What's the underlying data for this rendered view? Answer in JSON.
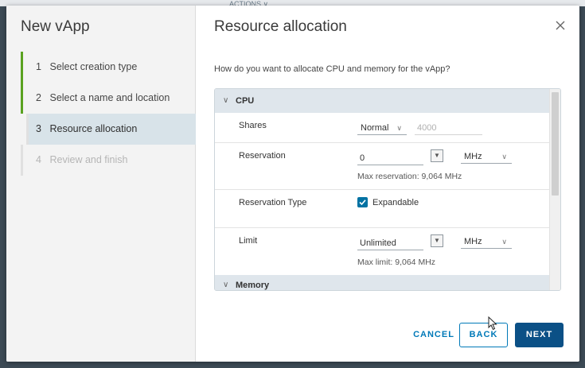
{
  "backdrop": {
    "fragment": "ACTIONS ∨"
  },
  "wizard": {
    "title": "New vApp",
    "steps": [
      {
        "num": "1",
        "label": "Select creation type",
        "state": "done"
      },
      {
        "num": "2",
        "label": "Select a name and location",
        "state": "done"
      },
      {
        "num": "3",
        "label": "Resource allocation",
        "state": "active"
      },
      {
        "num": "4",
        "label": "Review and finish",
        "state": "disabled"
      }
    ]
  },
  "page": {
    "title": "Resource allocation",
    "question": "How do you want to allocate CPU and memory for the vApp?"
  },
  "cpu": {
    "section_label": "CPU",
    "shares": {
      "label": "Shares",
      "level": "Normal",
      "value": "4000"
    },
    "reservation": {
      "label": "Reservation",
      "value": "0",
      "unit": "MHz",
      "hint": "Max reservation: 9,064 MHz"
    },
    "reservation_type": {
      "label": "Reservation Type",
      "checkbox_label": "Expandable",
      "checked": true
    },
    "limit": {
      "label": "Limit",
      "value": "Unlimited",
      "unit": "MHz",
      "hint": "Max limit: 9,064 MHz"
    }
  },
  "memory": {
    "section_label": "Memory"
  },
  "footer": {
    "cancel": "CANCEL",
    "back": "BACK",
    "next": "NEXT"
  },
  "colors": {
    "accent": "#0079b8",
    "primary_button": "#0b5086",
    "step_done": "#5aa220",
    "section_header": "#dfe6ec"
  },
  "icons": {
    "close": "close-icon",
    "chevron": "chevron-down-icon",
    "check": "check-icon",
    "cursor": "mouse-cursor-icon"
  }
}
